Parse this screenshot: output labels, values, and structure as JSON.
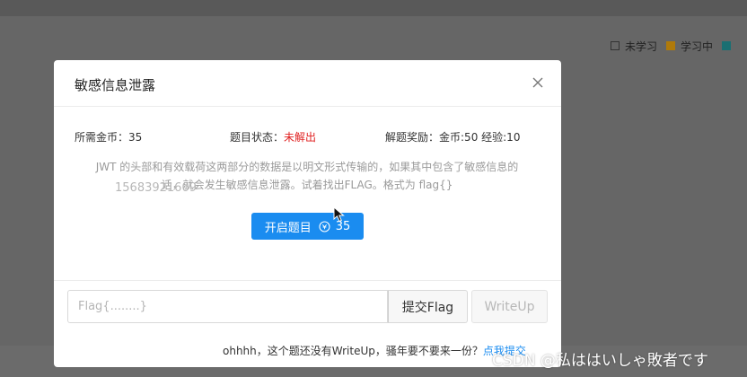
{
  "legend": {
    "items": [
      {
        "label": "未学习",
        "color": "#333333"
      },
      {
        "label": "学习中",
        "color": "#b07a0a"
      },
      {
        "label": "",
        "color": "#1a6f72"
      }
    ]
  },
  "modal": {
    "title": "敏感信息泄露",
    "info": {
      "cost_label": "所需金币：",
      "cost_value": "35",
      "status_label": "题目状态：",
      "status_value": "未解出",
      "reward_label": "解题奖励：",
      "reward_value": "金币:50 经验:10"
    },
    "description_line1": "JWT 的头部和有效载荷这两部分的数据是以明文形式传输的，如果其中包含了敏感信息的",
    "description_line2": "话，就会发生敏感信息泄露。试着找出FLAG。格式为 flag{}",
    "watermark_number": "15683921609",
    "start_button": {
      "label": "开启题目",
      "cost": "35",
      "color": "#1a8cf0"
    },
    "flag_input": {
      "value": "",
      "placeholder": "Flag{........}"
    },
    "submit_button": "提交Flag",
    "writeup_button": "WriteUp",
    "footer": {
      "text": "ohhhh，这个题还没有WriteUp，骚年要不要来一份？",
      "link": "点我提交"
    }
  },
  "watermark": "CSDN @私ははいしゃ敗者です"
}
